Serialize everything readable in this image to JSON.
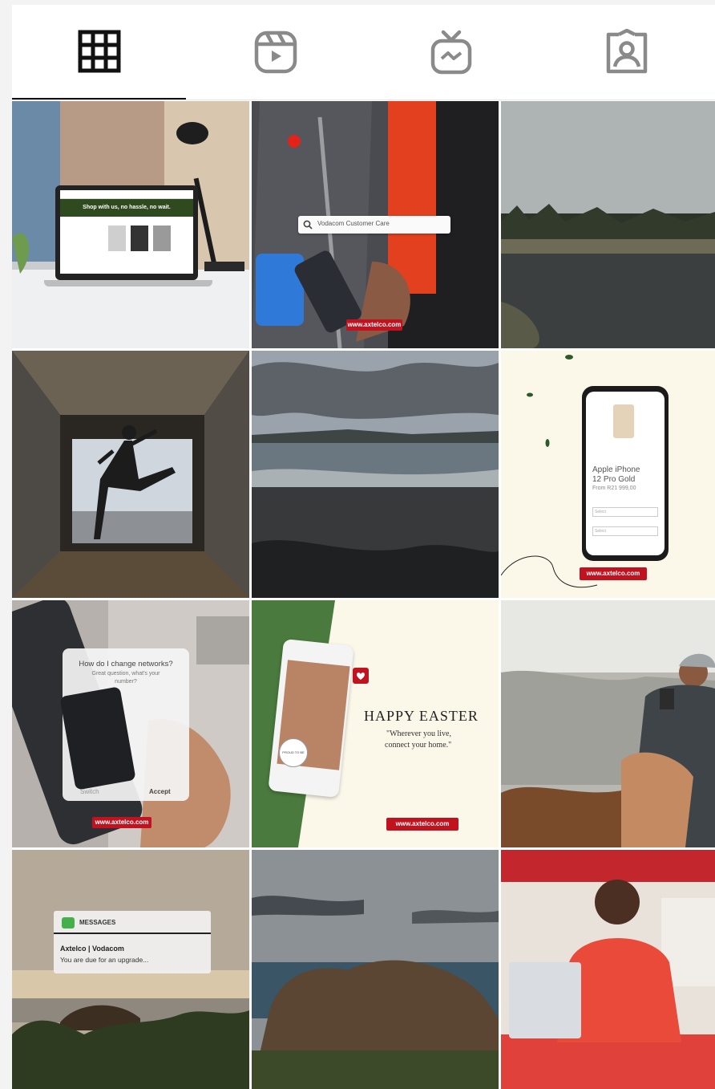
{
  "tabs": [
    {
      "id": "posts",
      "icon": "grid-icon",
      "active": true
    },
    {
      "id": "reels",
      "icon": "reels-icon",
      "active": false
    },
    {
      "id": "igtv",
      "icon": "igtv-icon",
      "active": false
    },
    {
      "id": "tagged",
      "icon": "tagged-user-icon",
      "active": false
    }
  ],
  "posts": {
    "p1": {
      "banner": "Shop with us, no hassle, no wait."
    },
    "p2": {
      "search": "Vodacom Customer Care",
      "url": "www.axtelco.com"
    },
    "p6": {
      "title_line1": "Apple iPhone",
      "title_line2": "12 Pro Gold",
      "price": "From R21 999,00",
      "url": "www.axtelco.com",
      "select1": "Select",
      "select2": "Select"
    },
    "p7": {
      "question": "How do I change networks?",
      "sub_line1": "Great question, what's your",
      "sub_line2": "number?",
      "left": "Switch",
      "right": "Accept",
      "url": "www.axtelco.com"
    },
    "p8": {
      "heading": "HAPPY EASTER",
      "quote_line1": "\"Wherever you live,",
      "quote_line2": "connect your home.\"",
      "url": "www.axtelco.com",
      "stamp": "PROUD TO BE"
    },
    "p10": {
      "app": "MESSAGES",
      "sender": "Axtelco | Vodacom",
      "message": "You are due for an upgrade..."
    }
  },
  "colors": {
    "accent": "#c1121f",
    "green": "#4a7a3d",
    "cream": "#fbf8ea"
  }
}
